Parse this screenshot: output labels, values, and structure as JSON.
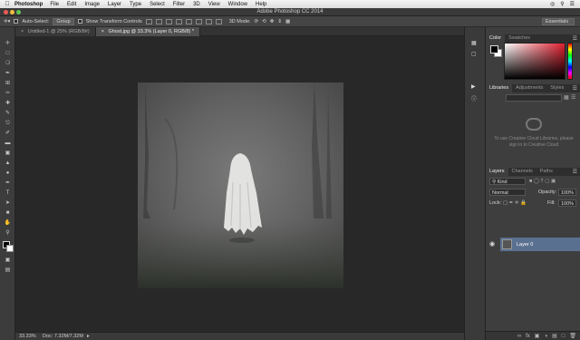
{
  "menubar": {
    "app_name": "Photoshop",
    "items": [
      "File",
      "Edit",
      "Image",
      "Layer",
      "Type",
      "Select",
      "Filter",
      "3D",
      "View",
      "Window",
      "Help"
    ]
  },
  "window": {
    "title": "Adobe Photoshop CC 2014"
  },
  "options": {
    "auto_select_label": "Auto-Select:",
    "auto_select_value": "Group",
    "show_transform_label": "Show Transform Controls",
    "mode_3d_label": "3D Mode:",
    "workspace_label": "Essentials"
  },
  "tabs": [
    {
      "close": "×",
      "label": "Untitled-1 @ 25% (RGB/8#)"
    },
    {
      "close": "×",
      "label": "Ghost.jpg @ 33.3% (Layer 0, RGB/8) *"
    }
  ],
  "status": {
    "zoom": "33.33%",
    "doc_info": "Doc: 7.32M/7.32M"
  },
  "color_panel": {
    "tabs": [
      "Color",
      "Swatches"
    ],
    "accent": "#e02030"
  },
  "libraries_panel": {
    "tabs": [
      "Libraries",
      "Adjustments",
      "Styles"
    ],
    "message": "To use Creative Cloud Libraries, please sign in to Creative Cloud"
  },
  "layers_panel": {
    "tabs": [
      "Layers",
      "Channels",
      "Paths"
    ],
    "filter_label": "Kind",
    "blend_mode": "Normal",
    "opacity_label": "Opacity:",
    "opacity_value": "100%",
    "lock_label": "Lock:",
    "fill_label": "Fill:",
    "fill_value": "100%",
    "layers": [
      {
        "name": "Layer 0",
        "visible": true,
        "selected": true
      }
    ]
  }
}
